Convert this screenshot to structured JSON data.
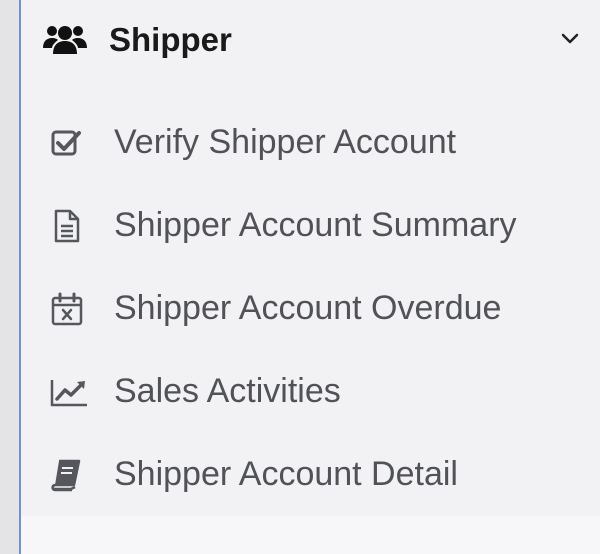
{
  "menu": {
    "group_title": "Shipper",
    "group_icon": "users-icon",
    "expanded": true,
    "items": [
      {
        "label": "Verify Shipper Account",
        "icon": "check-square-icon"
      },
      {
        "label": "Shipper Account Summary",
        "icon": "file-text-icon"
      },
      {
        "label": "Shipper Account Overdue",
        "icon": "calendar-x-icon"
      },
      {
        "label": "Sales Activities",
        "icon": "line-chart-icon"
      },
      {
        "label": "Shipper Account Detail",
        "icon": "book-icon"
      }
    ]
  },
  "colors": {
    "sidebar_bg": "#f2f2f4",
    "border_accent": "#6f8fd6",
    "title_text": "#1a1a1a",
    "item_text": "#505258"
  }
}
